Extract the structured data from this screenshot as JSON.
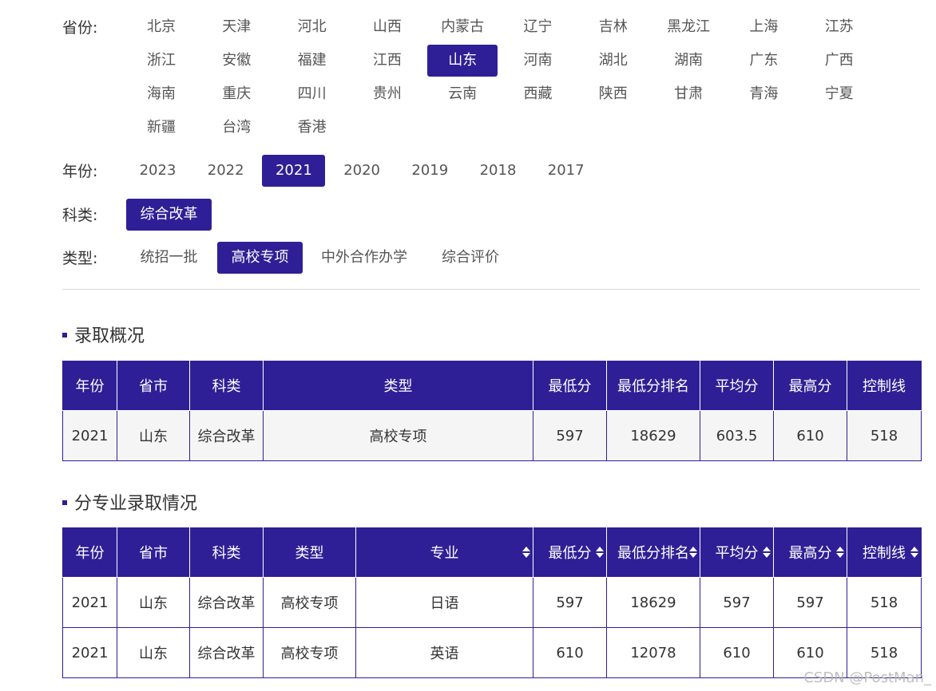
{
  "filters": {
    "province_label": "省份:",
    "provinces": [
      "北京",
      "天津",
      "河北",
      "山西",
      "内蒙古",
      "辽宁",
      "吉林",
      "黑龙江",
      "上海",
      "江苏",
      "浙江",
      "安徽",
      "福建",
      "江西",
      "山东",
      "河南",
      "湖北",
      "湖南",
      "广东",
      "广西",
      "海南",
      "重庆",
      "四川",
      "贵州",
      "云南",
      "西藏",
      "陕西",
      "甘肃",
      "青海",
      "宁夏",
      "新疆",
      "台湾",
      "香港"
    ],
    "province_selected": "山东",
    "year_label": "年份:",
    "years": [
      "2023",
      "2022",
      "2021",
      "2020",
      "2019",
      "2018",
      "2017"
    ],
    "year_selected": "2021",
    "category_label": "科类:",
    "categories": [
      "综合改革"
    ],
    "category_selected": "综合改革",
    "type_label": "类型:",
    "types": [
      "统招一批",
      "高校专项",
      "中外合作办学",
      "综合评价"
    ],
    "type_selected": "高校专项"
  },
  "summary": {
    "title": "录取概况",
    "headers": [
      "年份",
      "省市",
      "科类",
      "类型",
      "最低分",
      "最低分排名",
      "平均分",
      "最高分",
      "控制线"
    ],
    "rows": [
      [
        "2021",
        "山东",
        "综合改革",
        "高校专项",
        "597",
        "18629",
        "603.5",
        "610",
        "518"
      ]
    ]
  },
  "majors": {
    "title": "分专业录取情况",
    "headers": [
      "年份",
      "省市",
      "科类",
      "类型",
      "专业",
      "最低分",
      "最低分排名",
      "平均分",
      "最高分",
      "控制线"
    ],
    "sortable": [
      false,
      false,
      false,
      false,
      true,
      true,
      true,
      true,
      true,
      true
    ],
    "rows": [
      [
        "2021",
        "山东",
        "综合改革",
        "高校专项",
        "日语",
        "597",
        "18629",
        "597",
        "597",
        "518"
      ],
      [
        "2021",
        "山东",
        "综合改革",
        "高校专项",
        "英语",
        "610",
        "12078",
        "610",
        "610",
        "518"
      ]
    ]
  },
  "watermark": "CSDN @PostMan_"
}
